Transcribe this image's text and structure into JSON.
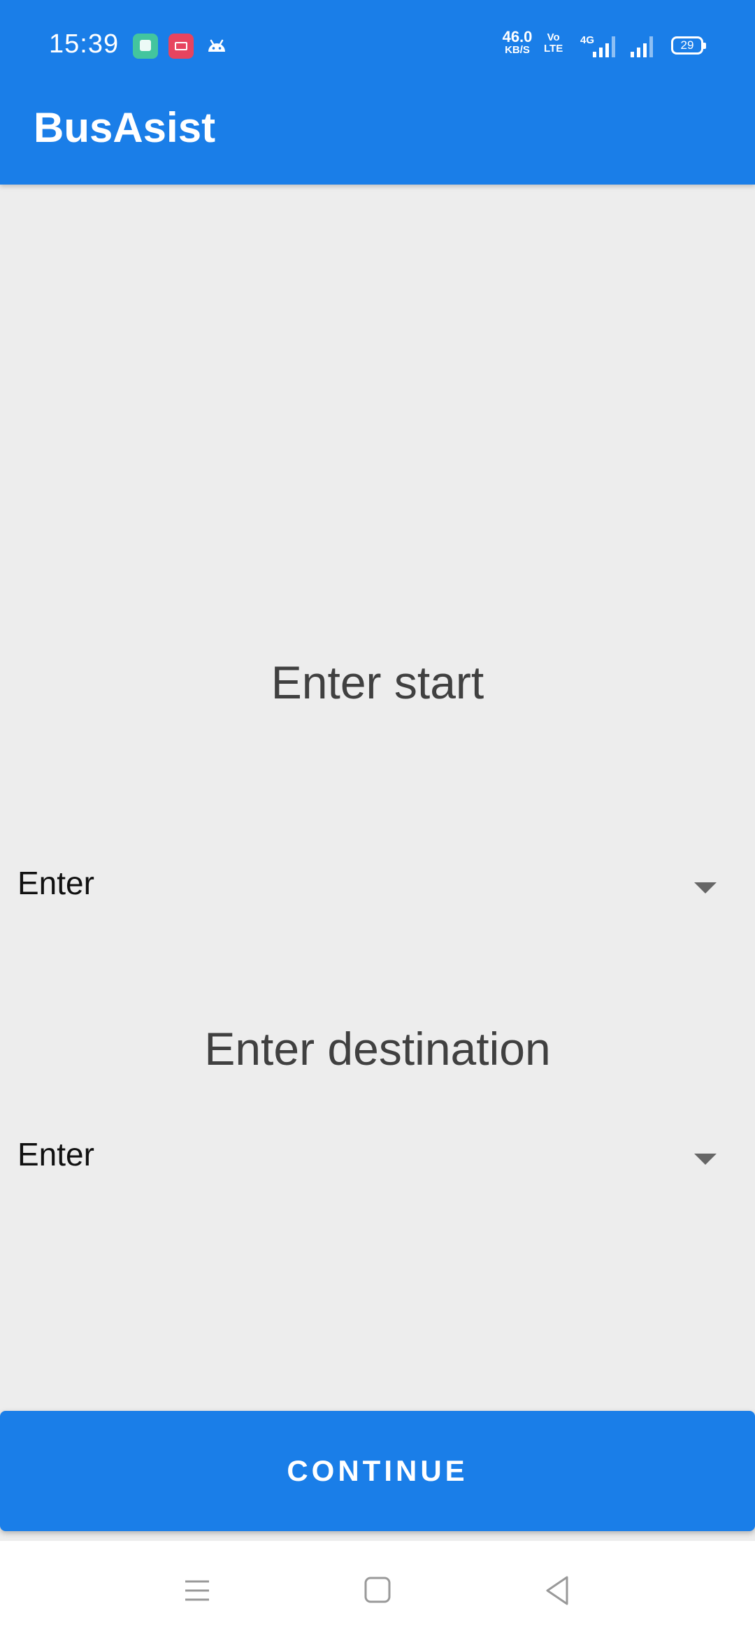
{
  "status_bar": {
    "time": "15:39",
    "net_speed_value": "46.0",
    "net_speed_unit": "KB/S",
    "volte_top": "Vo",
    "volte_bottom": "LTE",
    "network_type": "4G",
    "battery": "29"
  },
  "app_bar": {
    "title": "BusAsist"
  },
  "form": {
    "start_heading": "Enter start",
    "start_selected": "Enter",
    "destination_heading": "Enter destination",
    "destination_selected": "Enter"
  },
  "continue_button": {
    "label": "CONTINUE"
  },
  "colors": {
    "primary": "#1a7ee8",
    "background": "#ededed",
    "heading_text": "#404040"
  },
  "icons": {
    "notifications": [
      "app-notification-icon",
      "screen-recorder-icon",
      "android-icon"
    ],
    "nav": [
      "menu-icon",
      "home-icon",
      "back-icon"
    ]
  }
}
